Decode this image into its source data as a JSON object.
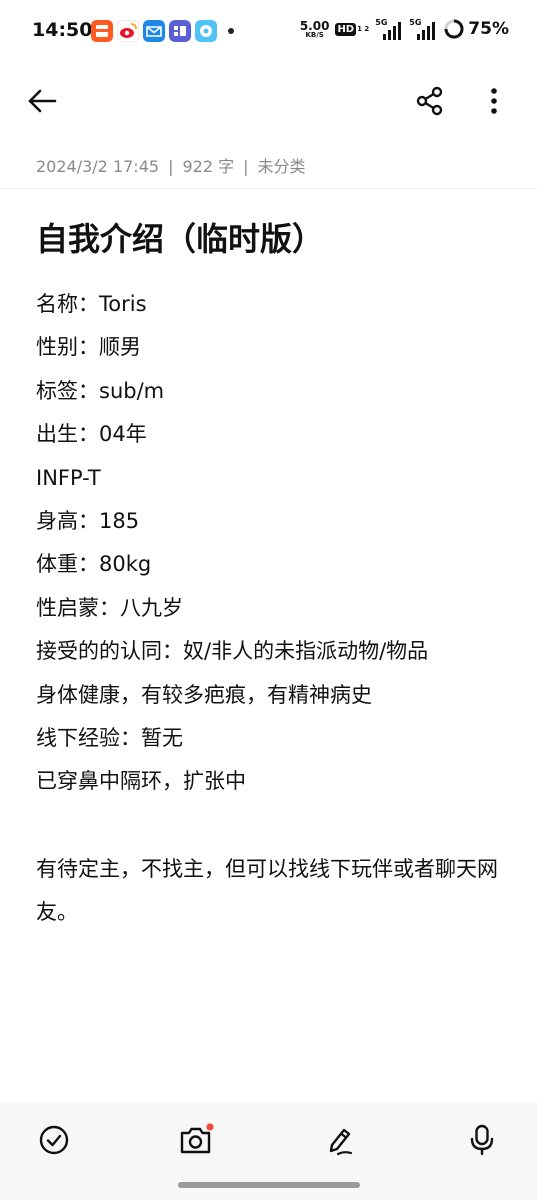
{
  "status_bar": {
    "time": "14:50",
    "network_speed_value": "5.00",
    "network_speed_unit": "KB/S",
    "hd_label": "HD",
    "hd_sub": "1 2",
    "signal1_label": "5G",
    "signal2_label": "5G",
    "battery_percent": "75%",
    "notification_icons": [
      "taobao-icon",
      "weibo-icon",
      "mail-icon",
      "tieba-icon",
      "app-icon"
    ]
  },
  "toolbar": {
    "back_icon": "arrow-left-icon",
    "share_icon": "share-icon",
    "more_icon": "more-vertical-icon"
  },
  "note": {
    "date": "2024/3/2 17:45",
    "word_count": "922 字",
    "category": "未分类",
    "separator": "|",
    "title": "自我介绍（临时版）",
    "lines": [
      "名称：Toris",
      "性别：顺男",
      "标签：sub/m",
      "出生：04年",
      "INFP-T",
      "身高：185",
      "体重：80kg",
      "性启蒙：八九岁",
      "接受的的认同：奴/非人的未指派动物/物品",
      "身体健康，有较多疤痕，有精神病史",
      "线下经验：暂无",
      "已穿鼻中隔环，扩张中"
    ],
    "closing": "有待定主，不找主，但可以找线下玩伴或者聊天网友。"
  },
  "bottom_bar": {
    "icons": [
      "checkmark-circle-icon",
      "camera-icon",
      "pen-icon",
      "microphone-icon"
    ],
    "camera_badge_color": "#f04a3e"
  },
  "colors": {
    "text": "#111111",
    "meta": "#8a8a8a",
    "bottom_bar_bg": "#f7f7f7"
  }
}
